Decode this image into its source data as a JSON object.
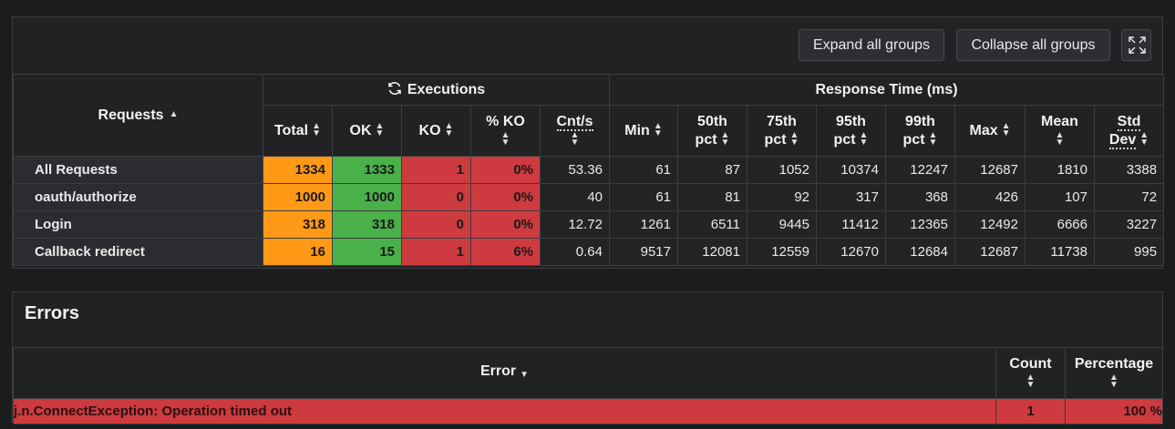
{
  "toolbar": {
    "expand_label": "Expand all groups",
    "collapse_label": "Collapse all groups"
  },
  "stats": {
    "headers": {
      "requests": "Requests",
      "executions": "Executions",
      "response_time": "Response Time (ms)",
      "total": "Total",
      "ok": "OK",
      "ko": "KO",
      "pct_ko": "% KO",
      "cnt_s": "Cnt/s",
      "min": "Min",
      "p50_a": "50th",
      "p50_b": "pct",
      "p75_a": "75th",
      "p75_b": "pct",
      "p95_a": "95th",
      "p95_b": "pct",
      "p99_a": "99th",
      "p99_b": "pct",
      "max": "Max",
      "mean": "Mean",
      "std_a": "Std",
      "std_b": "Dev"
    },
    "rows": [
      {
        "name": "All Requests",
        "total": "1334",
        "ok": "1333",
        "ko": "1",
        "pct_ko": "0%",
        "cnt_s": "53.36",
        "min": "61",
        "p50": "87",
        "p75": "1052",
        "p95": "10374",
        "p99": "12247",
        "max": "12687",
        "mean": "1810",
        "std": "3388"
      },
      {
        "name": "oauth/authorize",
        "total": "1000",
        "ok": "1000",
        "ko": "0",
        "pct_ko": "0%",
        "cnt_s": "40",
        "min": "61",
        "p50": "81",
        "p75": "92",
        "p95": "317",
        "p99": "368",
        "max": "426",
        "mean": "107",
        "std": "72"
      },
      {
        "name": "Login",
        "total": "318",
        "ok": "318",
        "ko": "0",
        "pct_ko": "0%",
        "cnt_s": "12.72",
        "min": "1261",
        "p50": "6511",
        "p75": "9445",
        "p95": "11412",
        "p99": "12365",
        "max": "12492",
        "mean": "6666",
        "std": "3227"
      },
      {
        "name": "Callback redirect",
        "total": "16",
        "ok": "15",
        "ko": "1",
        "pct_ko": "6%",
        "cnt_s": "0.64",
        "min": "9517",
        "p50": "12081",
        "p75": "12559",
        "p95": "12670",
        "p99": "12684",
        "max": "12687",
        "mean": "11738",
        "std": "995"
      }
    ]
  },
  "errors": {
    "title": "Errors",
    "headers": {
      "error": "Error",
      "count": "Count",
      "percentage": "Percentage"
    },
    "rows": [
      {
        "message": "j.n.ConnectException: Operation timed out",
        "count": "1",
        "percentage": "100 %"
      }
    ]
  },
  "colors": {
    "background": "#1b1c1e",
    "panel": "#202224",
    "total": "#ff9916",
    "ok": "#4ab04a",
    "ko": "#cd3a3f"
  }
}
